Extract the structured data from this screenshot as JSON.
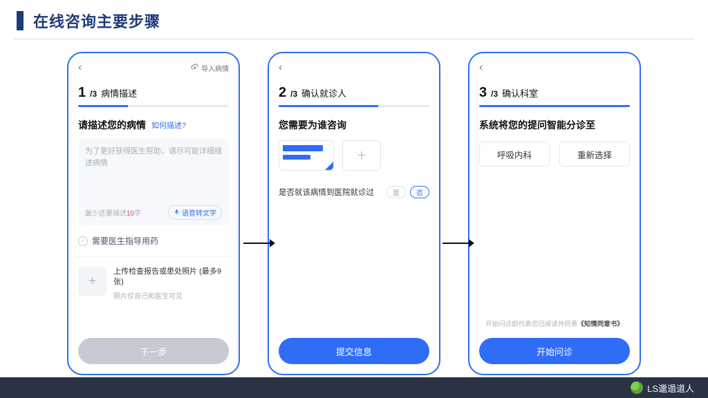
{
  "title": "在线咨询主要步骤",
  "footer_brand": "LS邋遢道人",
  "phones": [
    {
      "import_label": "导入病情",
      "step_current": "1",
      "step_total": "/3",
      "step_label": "病情描述",
      "progress_pct": 33,
      "section_title": "请描述您的病情",
      "section_link": "如何描述?",
      "placeholder": "为了更好获得医生帮助，请尽可能详细描述病情",
      "min_prefix": "最少还要描述",
      "min_count": "10",
      "min_suffix": "字",
      "voice_label": "语音转文字",
      "need_med_label": "需要医生指导用药",
      "upload_title": "上传检查报告或患处照片 (最多9张)",
      "upload_sub": "照片仅自己和医生可见",
      "button": "下一步"
    },
    {
      "step_current": "2",
      "step_total": "/3",
      "step_label": "确认就诊人",
      "progress_pct": 66,
      "section_title": "您需要为谁咨询",
      "question": "是否就该病情到医院就诊过",
      "seg_yes": "是",
      "seg_no": "否",
      "button": "提交信息"
    },
    {
      "step_current": "3",
      "step_total": "/3",
      "step_label": "确认科室",
      "progress_pct": 100,
      "section_title": "系统将您的提问智能分诊至",
      "choice_primary": "呼吸内科",
      "choice_secondary": "重新选择",
      "consent_prefix": "开始问诊即代表您已阅读并同意",
      "consent_link": "《知情同意书》",
      "button": "开始问诊"
    }
  ]
}
